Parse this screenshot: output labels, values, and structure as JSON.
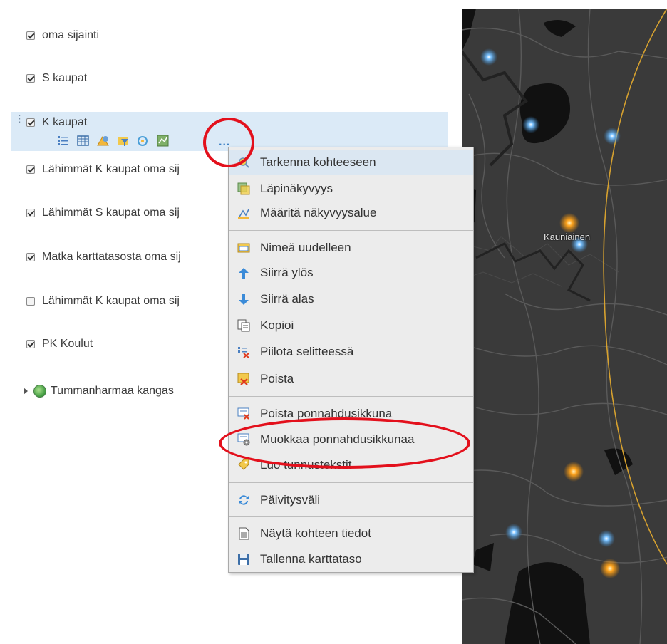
{
  "layers": [
    {
      "label": "oma sijainti",
      "checked": true
    },
    {
      "label": "S kaupat",
      "checked": true
    },
    {
      "label": "K kaupat",
      "checked": true,
      "selected": true
    },
    {
      "label": "Lähimmät K kaupat oma sij",
      "checked": true
    },
    {
      "label": "Lähimmät S kaupat oma sij",
      "checked": true
    },
    {
      "label": "Matka karttatasosta oma sij",
      "checked": true
    },
    {
      "label": "Lähimmät K kaupat oma sij",
      "checked": false
    },
    {
      "label": "PK Koulut",
      "checked": true
    }
  ],
  "basemap": {
    "label": "Tummanharmaa kangas"
  },
  "more_button": "...",
  "map": {
    "place_label": "Kauniainen"
  },
  "context_menu": {
    "items": [
      {
        "label": "Tarkenna kohteeseen",
        "icon": "zoom-to-icon"
      },
      {
        "label": "Läpinäkyvyys",
        "icon": "transparency-icon"
      },
      {
        "label": "Määritä näkyvyysalue",
        "icon": "visibility-range-icon"
      },
      {
        "label": "Nimeä uudelleen",
        "icon": "rename-icon"
      },
      {
        "label": "Siirrä ylös",
        "icon": "arrow-up-icon"
      },
      {
        "label": "Siirrä alas",
        "icon": "arrow-down-icon"
      },
      {
        "label": "Kopioi",
        "icon": "copy-icon"
      },
      {
        "label": "Piilota selitteessä",
        "icon": "hide-legend-icon"
      },
      {
        "label": "Poista",
        "icon": "remove-icon"
      },
      {
        "label": "Poista ponnahdusikkuna",
        "icon": "remove-popup-icon"
      },
      {
        "label": "Muokkaa ponnahdusikkunaa",
        "icon": "configure-popup-icon"
      },
      {
        "label": "Luo tunnustekstit",
        "icon": "create-labels-icon"
      },
      {
        "label": "Päivitysväli",
        "icon": "refresh-interval-icon"
      },
      {
        "label": "Näytä kohteen tiedot",
        "icon": "show-item-details-icon"
      },
      {
        "label": "Tallenna karttataso",
        "icon": "save-layer-icon"
      }
    ]
  },
  "colors": {
    "accent": "#3b7fc4",
    "selection": "#dbeaf7",
    "annotation": "#e3101c",
    "map_bg": "#3a3a3a"
  }
}
